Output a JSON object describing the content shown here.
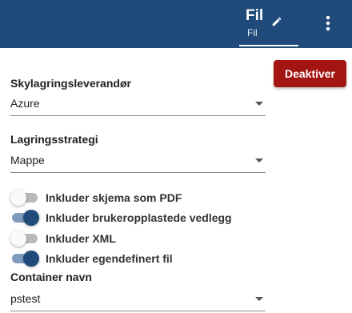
{
  "header": {
    "tab_title": "Fil",
    "tab_subtitle": "Fil",
    "edit_icon": "pencil-icon",
    "menu_icon": "more-vertical-icon",
    "background_color": "#1f4a7a"
  },
  "actions": {
    "deactivate_label": "Deaktiver",
    "deactivate_color": "#a31512"
  },
  "storage_provider": {
    "label": "Skylagringsleverandør",
    "value": "Azure"
  },
  "storage_strategy": {
    "label": "Lagringsstrategi",
    "value": "Mappe"
  },
  "toggles": [
    {
      "label": "Inkluder skjema som PDF",
      "checked": false
    },
    {
      "label": "Inkluder brukeropplastede vedlegg",
      "checked": true
    },
    {
      "label": "Inkluder XML",
      "checked": false
    },
    {
      "label": "Inkluder egendefinert fil",
      "checked": true
    }
  ],
  "container": {
    "label": "Container navn",
    "value": "pstest"
  }
}
